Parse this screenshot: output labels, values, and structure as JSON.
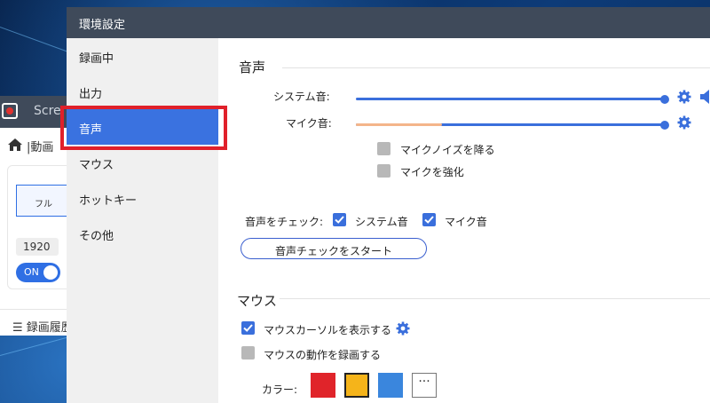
{
  "background_app": {
    "title": "Scre",
    "breadcrumb": "|動画",
    "full_label": "フル",
    "resolution": "1920",
    "toggle_label": "ON",
    "history_label": "録画履歴"
  },
  "prefs": {
    "title": "環境設定",
    "sidebar": [
      {
        "label": "録画中",
        "active": false
      },
      {
        "label": "出力",
        "active": false
      },
      {
        "label": "音声",
        "active": true
      },
      {
        "label": "マウス",
        "active": false
      },
      {
        "label": "ホットキー",
        "active": false
      },
      {
        "label": "その他",
        "active": false
      }
    ],
    "audio": {
      "section_title": "音声",
      "system_sound_label": "システム音:",
      "system_sound_level": 1.0,
      "mic_sound_label": "マイク音:",
      "mic_sound_level": 1.0,
      "mic_input_level": 0.28,
      "noise_reduction_label": "マイクノイズを降る",
      "noise_reduction_checked": false,
      "enhance_mic_label": "マイクを強化",
      "enhance_mic_checked": false,
      "check_label": "音声をチェック:",
      "check_system_label": "システム音",
      "check_system_checked": true,
      "check_mic_label": "マイク音",
      "check_mic_checked": true,
      "start_check_button": "音声チェックをスタート"
    },
    "mouse": {
      "section_title": "マウス",
      "show_cursor_label": "マウスカーソルを表示する",
      "show_cursor_checked": true,
      "record_clicks_label": "マウスの動作を録画する",
      "record_clicks_checked": false,
      "color_label": "カラー:",
      "colors": [
        "#e0242a",
        "#f5b41a",
        "#3a86dd"
      ],
      "selected_color": "#f5b41a",
      "more_label": "···"
    }
  },
  "colors": {
    "accent": "#3a72e0",
    "highlight_border": "#e0202a",
    "titlebar": "#3f4a5a",
    "mic_level": "#f4b58a"
  }
}
